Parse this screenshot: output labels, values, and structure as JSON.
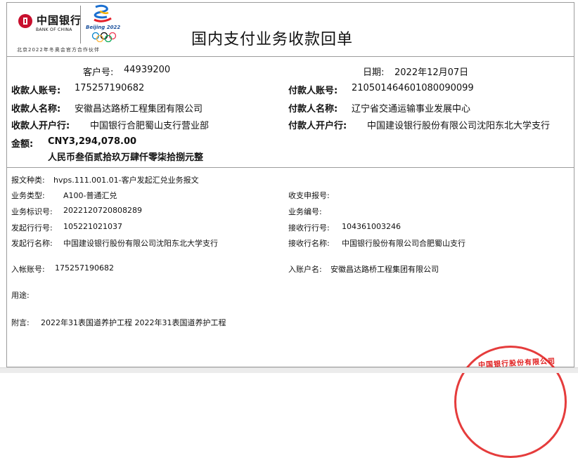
{
  "header": {
    "bank_name": "中国银行",
    "bank_name_en": "BANK OF CHINA",
    "games_text": "Beijing 2022",
    "tagline": "北京2022年冬奥会官方合作伙伴",
    "title": "国内支付业务收款回单"
  },
  "summary": {
    "customer_no_label": "客户号:",
    "customer_no": "44939200",
    "date_label": "日期:",
    "date": "2022年12月07日"
  },
  "payee": {
    "account_label": "收款人账号:",
    "account": "175257190682",
    "name_label": "收款人名称:",
    "name": "安徽昌达路桥工程集团有限公司",
    "bank_label": "收款人开户行:",
    "bank": "中国银行合肥蜀山支行营业部"
  },
  "payer": {
    "account_label": "付款人账号:",
    "account": "210501464601080090099",
    "name_label": "付款人名称:",
    "name": "辽宁省交通运输事业发展中心",
    "bank_label": "付款人开户行:",
    "bank": "中国建设银行股份有限公司沈阳东北大学支行"
  },
  "amount": {
    "label": "金额:",
    "value": "CNY3,294,078.00",
    "in_words": "人民币叁佰贰拾玖万肆仟零柒拾捌元整"
  },
  "details": {
    "msg_type_label": "报文种类:",
    "msg_type": "hvps.111.001.01-客户发起汇兑业务报文",
    "biz_type_label": "业务类型:",
    "biz_type": "A100-普通汇兑",
    "pay_ref_label": "收支申报号:",
    "pay_ref": "",
    "biz_id_label": "业务标识号:",
    "biz_id": "2022120720808289",
    "biz_no_label": "业务编号:",
    "biz_no": "",
    "send_bank_no_label": "发起行行号:",
    "send_bank_no": "105221021037",
    "recv_bank_no_label": "接收行行号:",
    "recv_bank_no": "104361003246",
    "send_bank_name_label": "发起行名称:",
    "send_bank_name": "中国建设银行股份有限公司沈阳东北大学支行",
    "recv_bank_name_label": "接收行名称:",
    "recv_bank_name": "中国银行股份有限公司合肥蜀山支行",
    "in_account_label": "入帐账号:",
    "in_account": "175257190682",
    "in_account_name_label": "入账户名:",
    "in_account_name": "安徽昌达路桥工程集团有限公司",
    "purpose_label": "用途:",
    "purpose": "",
    "remark_label": "附言:",
    "remark": "2022年31表国道养护工程 2022年31表国道养护工程"
  },
  "stamp": {
    "text": "中国银行股份有限公司"
  },
  "colors": {
    "stamp_red": "#e01a1a",
    "boc_red": "#c8102e",
    "border_gray": "#9c9c9c"
  }
}
